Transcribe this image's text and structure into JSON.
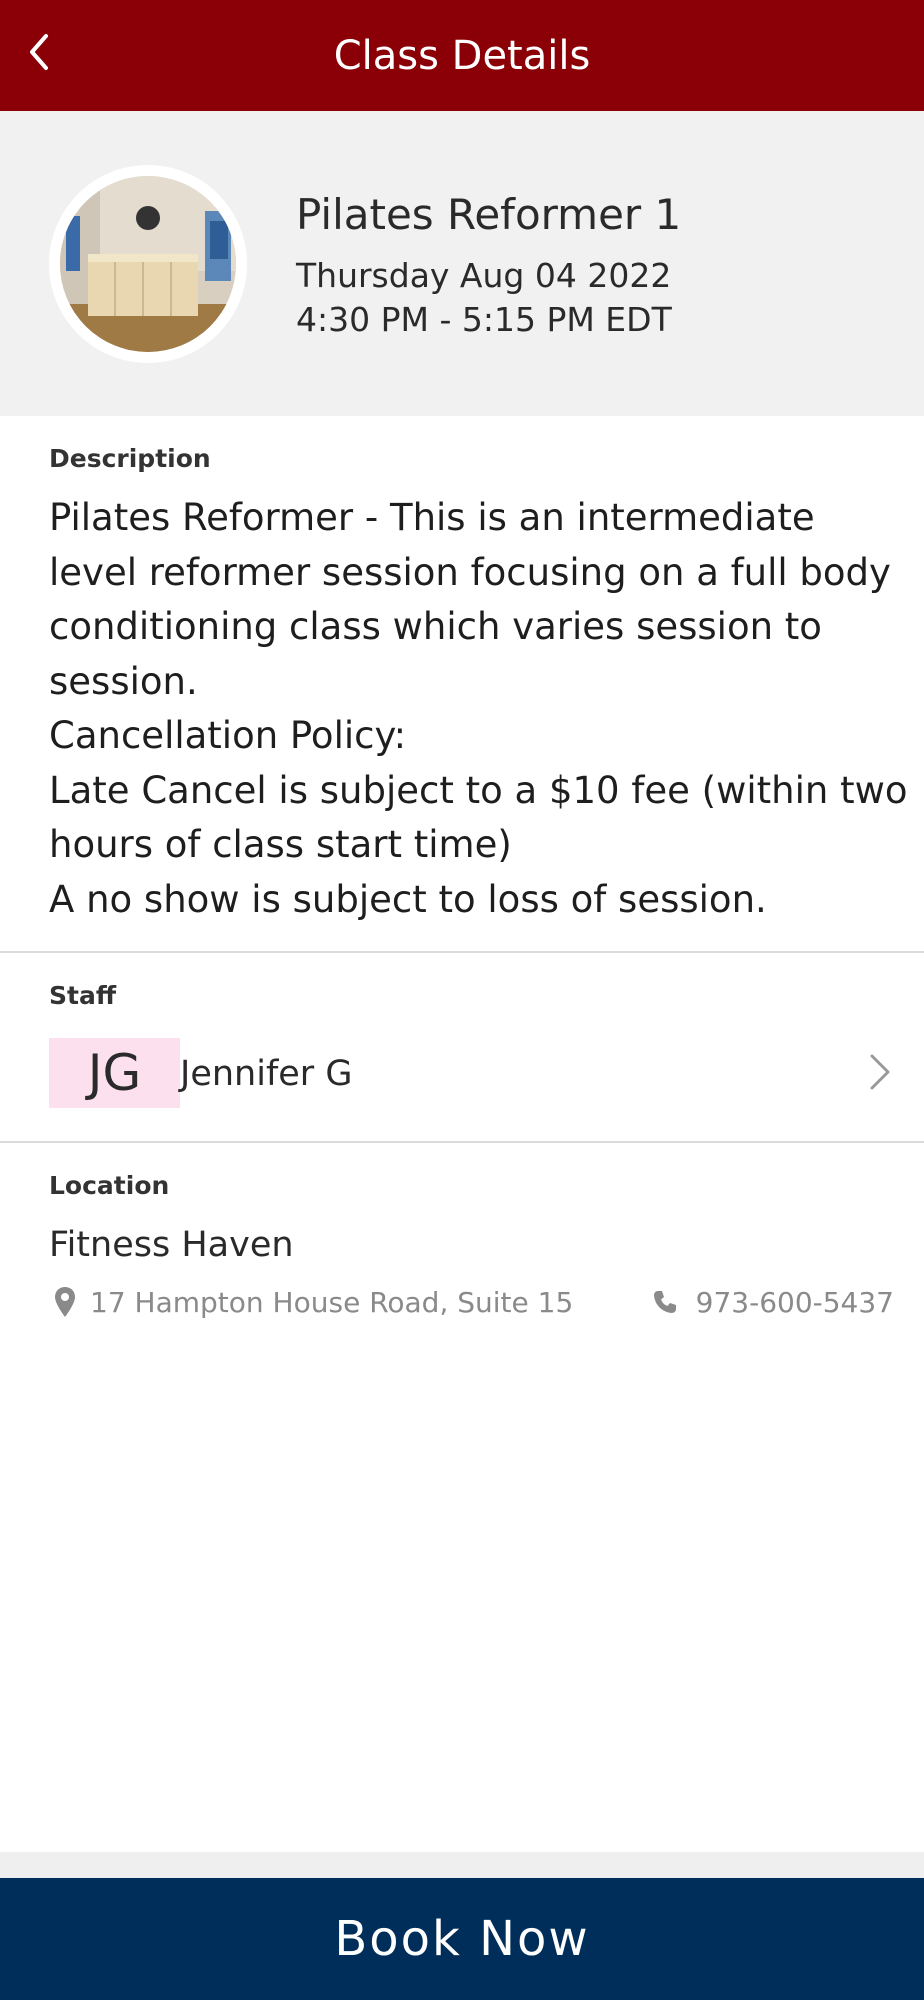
{
  "header": {
    "title": "Class Details",
    "back_icon": "chevron-left-icon",
    "background_color": "#8b0006"
  },
  "class_info": {
    "name": "Pilates Reformer 1",
    "date": "Thursday Aug 04 2022",
    "time": "4:30 PM - 5:15 PM EDT"
  },
  "description": {
    "label": "Description",
    "lines": [
      "Pilates Reformer - This is an intermediate",
      "level reformer session focusing on a full body",
      "conditioning class which varies session to",
      "session.",
      "Cancellation Policy:",
      "Late Cancel is subject to a $10 fee (within two",
      "hours of class start time)",
      "A no show is subject to loss of session."
    ]
  },
  "staff": {
    "label": "Staff",
    "initials": "JG",
    "name": "Jennifer G",
    "avatar_color": "#fde0ee"
  },
  "location": {
    "label": "Location",
    "name": "Fitness Haven",
    "address": "17 Hampton House Road, Suite 15",
    "phone": "973-600-5437"
  },
  "footer": {
    "book_label": "Book Now",
    "background_color": "#002e5b"
  }
}
